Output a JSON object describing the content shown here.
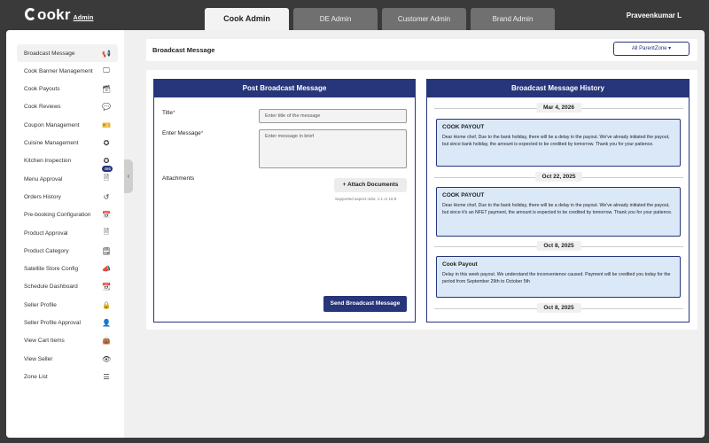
{
  "brand": {
    "name": "ookr",
    "sub": "Admin"
  },
  "tabs": [
    {
      "label": "Cook Admin",
      "active": true
    },
    {
      "label": "DE Admin",
      "active": false
    },
    {
      "label": "Customer Admin",
      "active": false
    },
    {
      "label": "Brand Admin",
      "active": false
    }
  ],
  "user": {
    "name": "Praveenkumar L"
  },
  "sidebar": {
    "items": [
      {
        "label": "Broadcast Message",
        "icon": "megaphone-icon",
        "glyph": "📢",
        "active": true
      },
      {
        "label": "Cook Banner Management",
        "icon": "monitor-icon",
        "glyph": "🖵"
      },
      {
        "label": "Cook Payouts",
        "icon": "archive-icon",
        "glyph": "🗃"
      },
      {
        "label": "Cook Reviews",
        "icon": "chat-icon",
        "glyph": "💬"
      },
      {
        "label": "Coupon Management",
        "icon": "ticket-icon",
        "glyph": "🎫"
      },
      {
        "label": "Cuisine Management",
        "icon": "star-icon",
        "glyph": "✪"
      },
      {
        "label": "Kitchen Inspection",
        "icon": "badge-star-icon",
        "glyph": "✪"
      },
      {
        "label": "Menu Approval",
        "icon": "document-icon",
        "glyph": "🗎",
        "badge": "486"
      },
      {
        "label": "Orders History",
        "icon": "history-icon",
        "glyph": "↺"
      },
      {
        "label": "Pre-booking Configuration",
        "icon": "calendar-icon",
        "glyph": "📅"
      },
      {
        "label": "Product Approval",
        "icon": "file-check-icon",
        "glyph": "🗎"
      },
      {
        "label": "Product Category",
        "icon": "file-list-icon",
        "glyph": "🗒"
      },
      {
        "label": "Satellite Store Config",
        "icon": "megaphone-icon",
        "glyph": "📣"
      },
      {
        "label": "Schedule Dashboard",
        "icon": "calendar-check-icon",
        "glyph": "📆"
      },
      {
        "label": "Seller Profile",
        "icon": "lock-icon",
        "glyph": "🔒"
      },
      {
        "label": "Seller Profile Approval",
        "icon": "user-icon",
        "glyph": "👤"
      },
      {
        "label": "View Cart Items",
        "icon": "bag-icon",
        "glyph": "👜"
      },
      {
        "label": "View Seller",
        "icon": "eye-icon",
        "glyph": "👁"
      },
      {
        "label": "Zone List",
        "icon": "list-icon",
        "glyph": "☰"
      }
    ]
  },
  "header": {
    "title": "Broadcast Message",
    "zone_label": "All ParentZone ▾"
  },
  "post_form": {
    "heading": "Post Broadcast Message",
    "title_label": "Title",
    "title_placeholder": "Enter title of the message",
    "message_label": "Enter Message",
    "message_placeholder": "Enter message in brief",
    "attachments_label": "Attachments",
    "attach_button": "+ Attach Documents",
    "attach_hint": "Supported aspect ratio: 1:1 or 16:9",
    "send_button": "Send Broadcast Message"
  },
  "history": {
    "heading": "Broadcast Message History",
    "entries": [
      {
        "date": "Mar 4, 2026",
        "title": "COOK PAYOUT",
        "body": "Dear Home chef, Due to the bank holiday, there will be a delay in the payout. We've already initiated the payout, but since bank holiday, the amount is expected to be credited by tomorrow. Thank you for your patience."
      },
      {
        "date": "Oct 22, 2025",
        "title": "COOK PAYOUT",
        "body": "Dear Home chef, Due to the bank holiday, there will be a delay in the payout. We've already initiated the payout, but since it's an NFET payment, the amount is expected to be credited by tomorrow. Thank you for your patience."
      },
      {
        "date": "Oct 8, 2025",
        "title": "Cook Payout",
        "body": "Delay in this week payout. We understand the inconvenience caused. Payment will be credited you today for the period from September 29th to October 5th"
      },
      {
        "date": "Oct 8, 2025"
      }
    ]
  },
  "colors": {
    "primary": "#27357a",
    "card_bg": "#dbe8f8"
  }
}
